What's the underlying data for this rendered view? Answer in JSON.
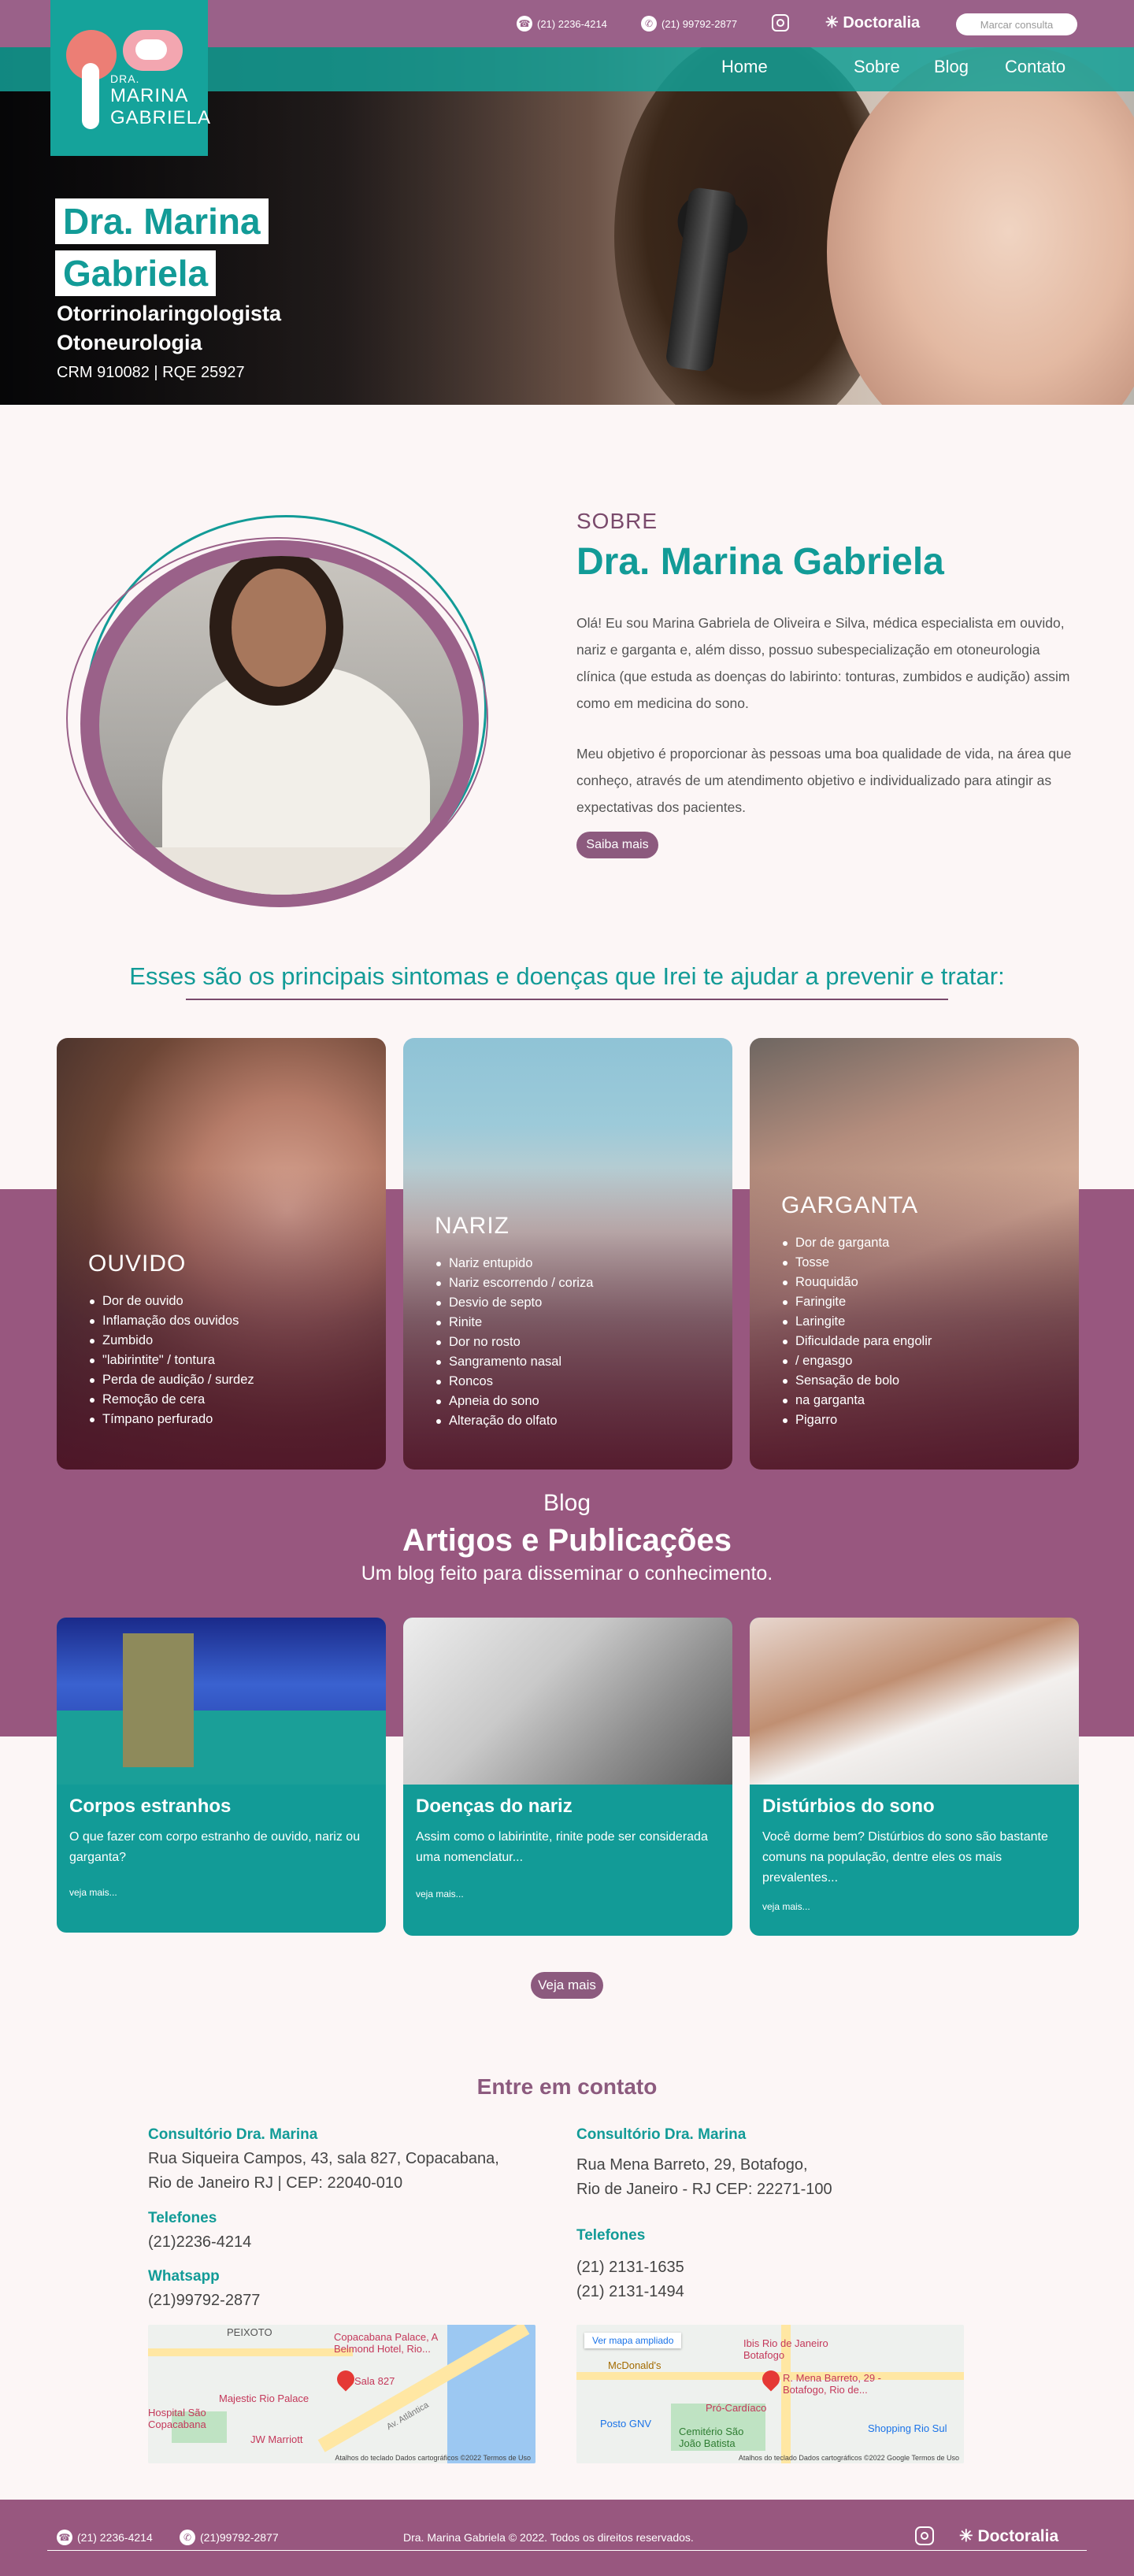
{
  "topbar": {
    "phone": "(21) 2236-4214",
    "whatsapp": "(21) 99792-2877",
    "doctoralia": "Doctoralia",
    "book_button": "Marcar consulta"
  },
  "logo": {
    "line1": "DRA.",
    "line2": "MARINA",
    "line3": "GABRIELA"
  },
  "nav": {
    "items": [
      "Home",
      "Sobre",
      "Blog",
      "Contato"
    ]
  },
  "hero": {
    "name_line1": "Dra. Marina",
    "name_line2": "Gabriela",
    "specialty1": "Otorrinolaringologista",
    "specialty2": "Otoneurologia",
    "registration": "CRM 910082 | RQE 25927"
  },
  "about": {
    "kicker": "SOBRE",
    "title": "Dra. Marina Gabriela",
    "paragraph1": "Olá! Eu sou Marina Gabriela de Oliveira e Silva, médica especialista em ouvido, nariz e garganta e, além disso, possuo subespecialização em otoneurologia clínica (que estuda as doenças do labirinto: tonturas, zumbidos e audição) assim como em medicina do sono.",
    "paragraph2": "Meu objetivo é proporcionar às pessoas uma boa qualidade de vida, na área que conheço, através de um atendimento objetivo e individualizado para atingir as expectativas dos pacientes.",
    "button": "Saiba mais"
  },
  "symptoms": {
    "heading": "Esses são os principais sintomas e doenças que Irei te ajudar a prevenir e tratar:",
    "cards": [
      {
        "title": "OUVIDO",
        "items": [
          "Dor de ouvido",
          "Inflamação dos ouvidos",
          "Zumbido",
          "\"labirintite\" / tontura",
          "Perda de audição / surdez",
          "Remoção de cera",
          "Tímpano perfurado"
        ]
      },
      {
        "title": "NARIZ",
        "items": [
          "Nariz entupido",
          "Nariz escorrendo / coriza",
          "Desvio de septo",
          "Rinite",
          "Dor no rosto",
          "Sangramento nasal",
          "Roncos",
          "Apneia do sono",
          "Alteração do olfato"
        ]
      },
      {
        "title": "GARGANTA",
        "items": [
          "Dor de garganta",
          "Tosse",
          "Rouquidão",
          "Faringite",
          "Laringite",
          "Dificuldade para engolir",
          "/ engasgo",
          "Sensação de bolo",
          "na garganta",
          "Pigarro"
        ]
      }
    ]
  },
  "blog": {
    "kicker": "Blog",
    "title": "Artigos e Publicações",
    "subtitle": "Um blog feito para disseminar o conhecimento.",
    "posts": [
      {
        "title": "Corpos estranhos",
        "excerpt": "O que fazer com corpo estranho de ouvido, nariz ou garganta?",
        "more": "veja mais..."
      },
      {
        "title": "Doenças do nariz",
        "excerpt": "Assim como o labirintite, rinite pode ser considerada uma nomenclatur...",
        "more": "veja mais..."
      },
      {
        "title": "Distúrbios do sono",
        "excerpt": "Você dorme bem? Distúrbios do sono são bastante comuns na população, dentre eles os mais prevalentes...",
        "more": "veja mais..."
      }
    ],
    "more_button": "Veja mais"
  },
  "contact": {
    "title": "Entre em contato",
    "left": {
      "office_title": "Consultório Dra. Marina",
      "address1": "Rua Siqueira Campos, 43, sala 827, Copacabana,",
      "address2": "Rio de Janeiro RJ | CEP: 22040-010",
      "phones_title": "Telefones",
      "phone1": "(21)2236-4214",
      "whatsapp_title": "Whatsapp",
      "whatsapp": "(21)99792-2877",
      "map_labels": [
        "PEIXOTO",
        "Copacabana Palace, A Belmond Hotel, Rio...",
        "Sala 827",
        "Majestic Rio Palace",
        "Hospital São Copacabana",
        "JW Marriott",
        "Av. Atlântica"
      ],
      "map_footer": "Atalhos do teclado   Dados cartográficos ©2022   Termos de Uso"
    },
    "right": {
      "office_title": "Consultório Dra. Marina",
      "address1": "Rua Mena Barreto, 29, Botafogo,",
      "address2": "Rio de Janeiro - RJ CEP: 22271-100",
      "phones_title": "Telefones",
      "phone1": "(21) 2131-1635",
      "phone2": "(21) 2131-1494",
      "map_button": "Ver mapa ampliado",
      "map_labels": [
        "Ibis Rio de Janeiro Botafogo",
        "McDonald's",
        "R. Mena Barreto, 29 - Botafogo, Rio de...",
        "Pró-Cardíaco",
        "Posto GNV",
        "Cemitério São João Batista",
        "Shopping Rio Sul"
      ],
      "map_footer": "Atalhos do teclado   Dados cartográficos ©2022 Google   Termos de Uso"
    }
  },
  "footer": {
    "phone": "(21) 2236-4214",
    "whatsapp": "(21)99792-2877",
    "copyright": "Dra. Marina Gabriela © 2022. Todos os direitos reservados.",
    "doctoralia": "Doctoralia"
  },
  "colors": {
    "teal": "#129b97",
    "plum": "#98577f",
    "background": "#fcf6f6"
  }
}
